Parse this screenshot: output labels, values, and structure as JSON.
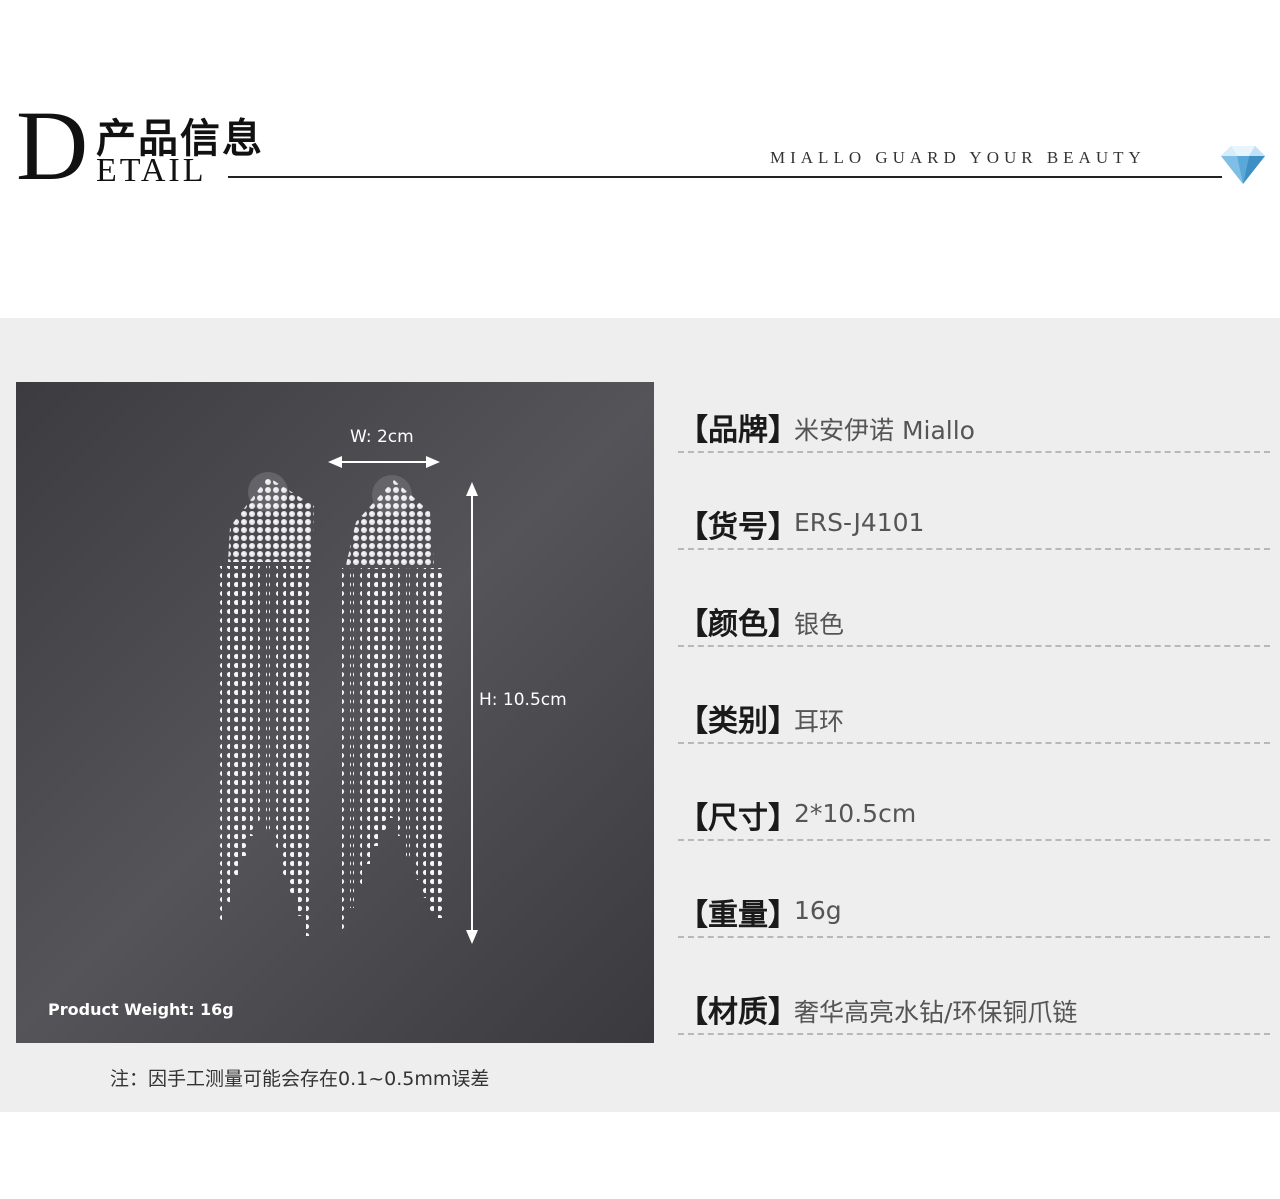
{
  "header": {
    "big_letter": "D",
    "title_cn": "产品信息",
    "title_en": "ETAIL",
    "slogan": "MIALLO GUARD YOUR BEAUTY",
    "logo_icon": "diamond-icon",
    "accent_color": "#5aa8d8"
  },
  "photo": {
    "width_label": "W: 2cm",
    "height_label": "H: 10.5cm",
    "weight_label": "Product Weight: 16g"
  },
  "note": "注：因手工测量可能会存在0.1~0.5mm误差",
  "specs": [
    {
      "key": "【品牌】",
      "value": "米安伊诺 Miallo"
    },
    {
      "key": "【货号】",
      "value": "ERS-J4101"
    },
    {
      "key": "【颜色】",
      "value": "银色"
    },
    {
      "key": "【类别】",
      "value": "耳环"
    },
    {
      "key": "【尺寸】",
      "value": "2*10.5cm"
    },
    {
      "key": "【重量】",
      "value": "16g"
    },
    {
      "key": "【材质】",
      "value": "奢华高亮水钻/环保铜爪链"
    }
  ]
}
